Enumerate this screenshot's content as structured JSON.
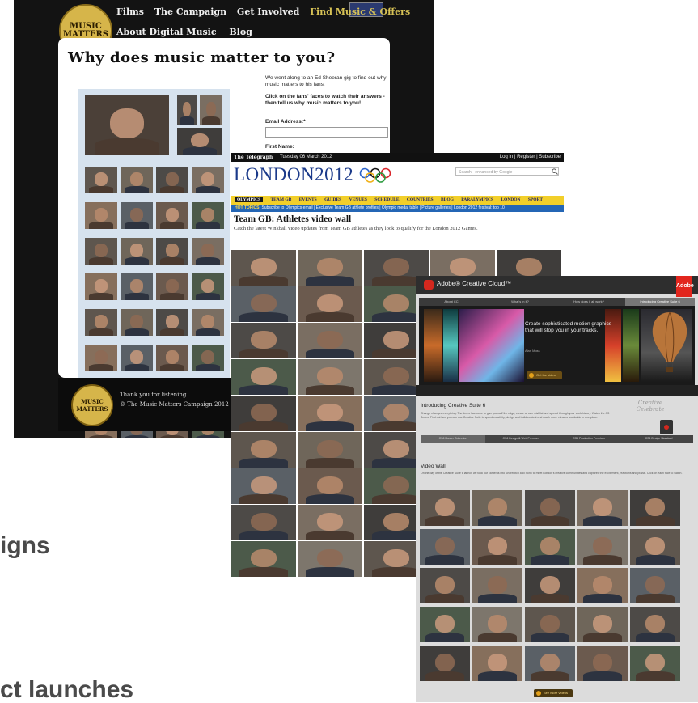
{
  "slide": {
    "line1": "igns",
    "line2": "ct launches"
  },
  "music_matters": {
    "logo": "MUSIC MATTERS",
    "nav": [
      "Films",
      "The Campaign",
      "Get Involved",
      "Find Music & Offers"
    ],
    "nav2": [
      "About Digital Music",
      "Blog"
    ],
    "title": "Why does music matter to you?",
    "intro": "We went along to an Ed Sheeran gig to find out why music matters to his fans.",
    "cta": "Click on the fans' faces to watch their answers - then tell us why music matters to you!",
    "email_label": "Email Address:*",
    "first_name_label": "First Name:",
    "footer_line1": "Thank you for listening",
    "footer_line2": "© The Music Matters Campaign 2012 -",
    "colors": {
      "background": "#131313",
      "gold": "#d6b54a",
      "highlight": "#d7c256"
    }
  },
  "telegraph": {
    "brand": "The Telegraph",
    "date": "Tuesday 06 March 2012",
    "login": "Log in | Register | Subscribe",
    "masthead": "LONDON2012",
    "search_placeholder": "Search - enhanced by Google",
    "nav": [
      "OLYMPICS",
      "TEAM GB",
      "EVENTS",
      "GUIDES",
      "VENUES",
      "SCHEDULE",
      "COUNTRIES",
      "BLOG",
      "PARALYMPICS",
      "LONDON",
      "SPORT"
    ],
    "hot_label": "HOT TOPICS:",
    "hot_topics": "Subscribe to Olympics email | Exclusive Team GB athlete profiles | Olympic medal table | Picture galleries | London 2012 festival: top 10",
    "headline": "Team GB: Athletes video wall",
    "subhead": "Catch the latest Winkball video updates from Team GB athletes as they look to qualify for the London 2012 Games.",
    "colors": {
      "nav_bar": "#f2cf2a",
      "hot_bar": "#2466b5",
      "masthead": "#1b3a8a"
    }
  },
  "adobe": {
    "header_title": "Adobe® Creative Cloud™",
    "adobe_logo": "Adobe",
    "tabs": [
      "About CC",
      "What's in it?",
      "How does it all work?",
      "Introducing Creative Suite 6"
    ],
    "hero_text": "Create sophisticated motion graphics that will stop you in your tracks.",
    "hero_byline": "Alan Moss",
    "hero_button": "Get the video",
    "intro_title": "Introducing Creative Suite 6",
    "intro_text": "Change changes everything. The times has come to give yourself the edge, create or own wishlist and spread through your work history. Watch the CS Series. Find out how you can use Creative Suite to speed creativity, design and build content and reach more viewers worldwide in one place.",
    "celebrate": "Creative Celebrate",
    "subtabs": [
      "CS6 Master Collection",
      "CS6 Design & Web Premium",
      "CS6 Production Premium",
      "CS6 Design Standard"
    ],
    "video_wall_title": "Video Wall",
    "video_wall_text": "On the day of the Creative Suite 6 launch we took our cameras into Shoreditch and Soho to meet London's creative communities and captured the excitement, reactions and praise. Click on each face to watch.",
    "more_button": "See more videos",
    "colors": {
      "red": "#d4281e",
      "dark": "#2e2e2e",
      "button": "#e3a01a"
    }
  }
}
